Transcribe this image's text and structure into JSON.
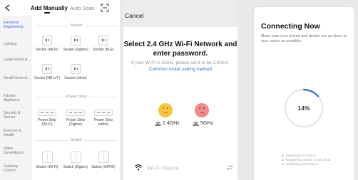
{
  "add_device": {
    "tabs": {
      "manual": "Add Manually",
      "scan": "Auto Scan"
    },
    "icons": {
      "back": "chevron-left-icon",
      "scan": "scan-frame-icon"
    },
    "categories": [
      {
        "label": "Electrical Engineering",
        "active": true
      },
      {
        "label": "Lighting",
        "active": false
      },
      {
        "label": "Large Home A...",
        "active": false
      },
      {
        "label": "Small Home A...",
        "active": false
      },
      {
        "label": "Kitchen Appliance",
        "active": false
      },
      {
        "label": "Security & Sensor",
        "active": false
      },
      {
        "label": "Exercise & Health",
        "active": false
      },
      {
        "label": "Video Surveillance",
        "active": false
      },
      {
        "label": "Gateway Control",
        "active": false
      }
    ],
    "sections": [
      {
        "title": "Socket",
        "items": [
          "Socket (Wi-Fi)",
          "Socket (Zigbee)",
          "Socket (BLE)",
          "Socket (NB-IoT)",
          "Socket (other)"
        ]
      },
      {
        "title": "Power Strip",
        "items": [
          "Power Strip (Wi-Fi)",
          "Power Strip (Zigbee)",
          "Power Strip (other)"
        ]
      },
      {
        "title": "Switch",
        "items": [
          "Switch (Wi-Fi)",
          "Switch (Zigbee)",
          "Switch (GPRS)"
        ]
      }
    ]
  },
  "wifi_setup": {
    "cancel": "Cancel",
    "title": "Select 2.4 GHz Wi-Fi Network and enter password.",
    "hint": "If your Wi-Fi is 5GHz, please set it to be 2.4GHz.",
    "hint_link": "Common router setting method",
    "band_ok": "2.4GHz",
    "band_bad": "5GHz",
    "wifi_placeholder": "Wi-Fi Name",
    "icons": {
      "ok": "smile-face-icon",
      "bad": "sad-face-icon",
      "wifi": "wifi-icon",
      "swap": "swap-arrows-icon"
    }
  },
  "connecting": {
    "title": "Connecting Now",
    "subtitle": "Make sure your phone and device are as close to your router as possible.",
    "progress": 0.14,
    "progress_label": "14%",
    "steps": [
      "Searching for Device",
      "Registering device to the cloud",
      "Initializing your Device"
    ],
    "colors": {
      "ring": "#2f6fd6",
      "track": "#e6e6ea"
    }
  }
}
